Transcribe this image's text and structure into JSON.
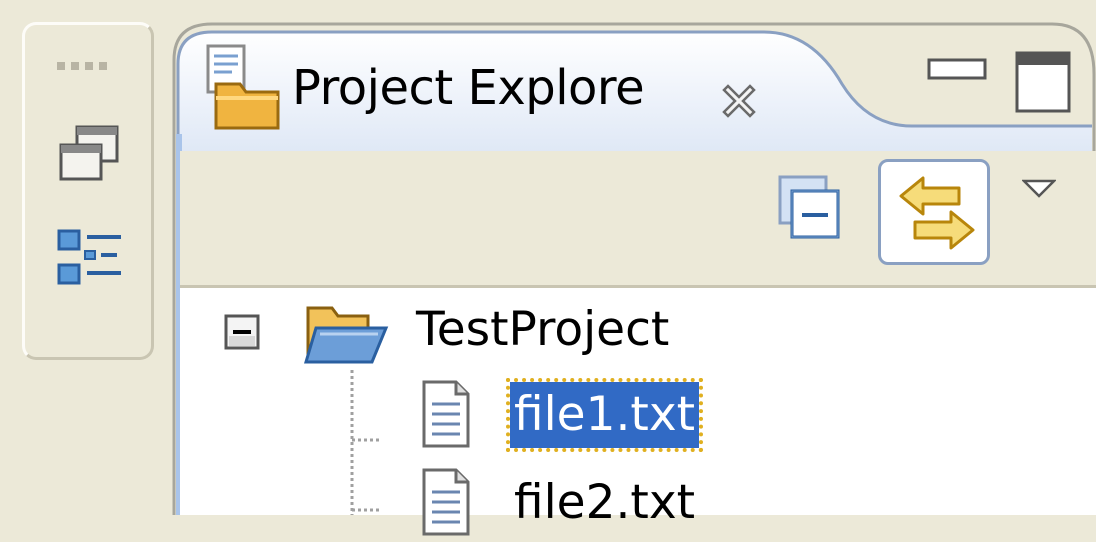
{
  "view": {
    "title": "Project Explore"
  },
  "tree": {
    "project": "TestProject",
    "files": [
      "file1.txt",
      "file2.txt"
    ],
    "selected_index": 0
  },
  "icons": {
    "view_icon": "project-explorer-icon",
    "close": "close-icon",
    "minimize": "minimize-icon",
    "maximize": "maximize-icon",
    "collapse_all": "collapse-all-icon",
    "link_with_editor": "link-with-editor-icon",
    "view_menu": "chevron-down-icon",
    "trim_restore": "restore-icon",
    "trim_outline": "outline-view-icon"
  },
  "colors": {
    "selection": "#316ac5",
    "tab_gradient_start": "#a9c4ea",
    "tab_gradient_end": "#ffffff",
    "background": "#ece9d8"
  }
}
